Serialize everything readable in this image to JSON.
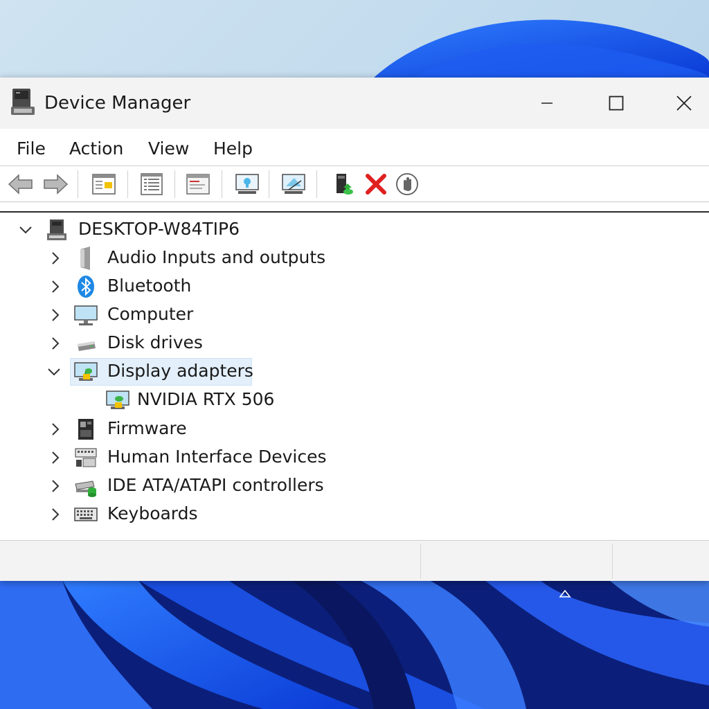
{
  "window": {
    "title": "Device Manager"
  },
  "menu": {
    "file": "File",
    "action": "Action",
    "view": "View",
    "help": "Help"
  },
  "toolbar": {
    "icons": [
      "back-arrow-icon",
      "forward-arrow-icon",
      "properties-icon",
      "show-hidden-list-icon",
      "update-driver-icon",
      "display-icon",
      "scan-hardware-changes-icon",
      "enable-device-icon",
      "uninstall-device-icon",
      "disable-device-icon"
    ]
  },
  "tree": {
    "root": "DESKTOP-W84TIP6",
    "categories": [
      {
        "label": "Audio Inputs and outputs",
        "icon": "speaker-icon",
        "expanded": false
      },
      {
        "label": "Bluetooth",
        "icon": "bluetooth-icon",
        "expanded": false
      },
      {
        "label": "Computer",
        "icon": "monitor-icon",
        "expanded": false
      },
      {
        "label": "Disk drives",
        "icon": "disk-drive-icon",
        "expanded": false
      },
      {
        "label": "Display adapters",
        "icon": "display-adapter-icon",
        "expanded": true,
        "selected": true
      },
      {
        "label": "Firmware",
        "icon": "firmware-icon",
        "expanded": false
      },
      {
        "label": "Human Interface Devices",
        "icon": "hid-icon",
        "expanded": false
      },
      {
        "label": "IDE ATA/ATAPI controllers",
        "icon": "ide-controller-icon",
        "expanded": false
      },
      {
        "label": "Keyboards",
        "icon": "keyboard-icon",
        "expanded": false
      }
    ],
    "display_child": "NVIDIA RTX 506"
  },
  "colors": {
    "selection": "#e3effa",
    "titlebar": "#f3f3f3",
    "uninstall_red": "#e02020"
  }
}
